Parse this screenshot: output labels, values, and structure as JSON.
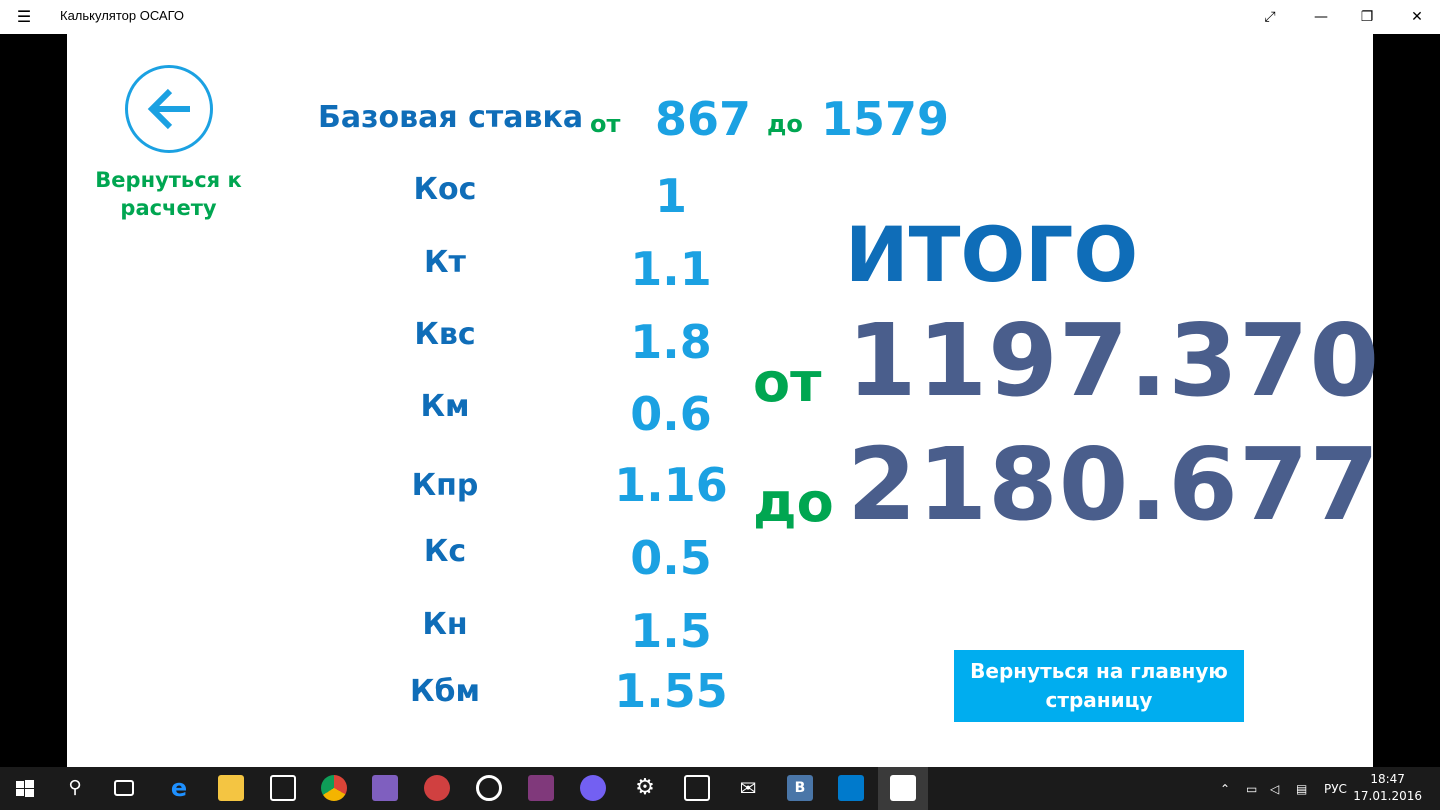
{
  "window": {
    "title": "Калькулятор ОСАГО"
  },
  "back": {
    "label": "Вернуться к расчету"
  },
  "base": {
    "label": "Базовая ставка",
    "from_word": "от",
    "from_value": "867",
    "to_word": "до",
    "to_value": "1579"
  },
  "coefficients": [
    {
      "name": "Кос",
      "value": "1"
    },
    {
      "name": "Кт",
      "value": "1.1"
    },
    {
      "name": "Квс",
      "value": "1.8"
    },
    {
      "name": "Км",
      "value": "0.6"
    },
    {
      "name": "Кпр",
      "value": "1.16"
    },
    {
      "name": "Кс",
      "value": "0.5"
    },
    {
      "name": "Кн",
      "value": "1.5"
    },
    {
      "name": "Кбм",
      "value": "1.55"
    }
  ],
  "total": {
    "title": "ИТОГО",
    "from_word": "от",
    "from_value": "1197.370",
    "to_word": "до",
    "to_value": "2180.677"
  },
  "main_button": {
    "label": "Вернуться на главную страницу"
  },
  "taskbar": {
    "language": "РУС",
    "time": "18:47",
    "date": "17.01.2016",
    "icons": [
      "start-icon",
      "search-icon",
      "task-view-icon",
      "edge-icon",
      "file-explorer-icon",
      "store-icon",
      "chrome-icon",
      "visual-studio-icon",
      "paint-icon",
      "groove-icon",
      "onenote-icon",
      "viber-icon",
      "settings-icon",
      "photos-icon",
      "mail-icon",
      "vk-icon",
      "vscode-icon",
      "osago-app-icon"
    ]
  },
  "colors": {
    "accent": "#1ba1e2",
    "green": "#00a651",
    "dark_blue": "#0f6db8",
    "total": "#4a5e8c",
    "button": "#00adef"
  }
}
